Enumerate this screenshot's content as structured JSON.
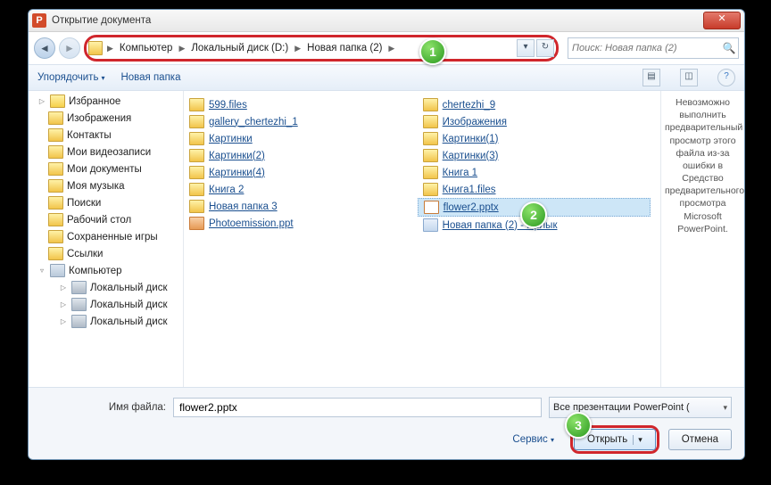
{
  "title": "Открытие документа",
  "breadcrumb": {
    "root": "Компьютер",
    "drive": "Локальный диск (D:)",
    "folder": "Новая папка (2)"
  },
  "search": {
    "placeholder": "Поиск: Новая папка (2)"
  },
  "toolbar": {
    "organize": "Упорядочить",
    "newfolder": "Новая папка"
  },
  "tree": {
    "favorites": "Избранное",
    "items": [
      "Изображения",
      "Контакты",
      "Мои видеозаписи",
      "Мои документы",
      "Моя музыка",
      "Поиски",
      "Рабочий стол",
      "Сохраненные игры",
      "Ссылки"
    ],
    "computer": "Компьютер",
    "drives": [
      "Локальный диск",
      "Локальный диск",
      "Локальный диск"
    ]
  },
  "files": {
    "col1": [
      {
        "name": "599.files",
        "type": "folder"
      },
      {
        "name": "gallery_chertezhi_1",
        "type": "folder"
      },
      {
        "name": "Картинки",
        "type": "folder"
      },
      {
        "name": "Картинки(2)",
        "type": "folder"
      },
      {
        "name": "Картинки(4)",
        "type": "folder"
      },
      {
        "name": "Книга 2",
        "type": "folder"
      },
      {
        "name": "Новая папка 3",
        "type": "folder"
      },
      {
        "name": "Photoemission.ppt",
        "type": "ppt"
      }
    ],
    "col2": [
      {
        "name": "chertezhi_9",
        "type": "folder"
      },
      {
        "name": "Изображения",
        "type": "folder"
      },
      {
        "name": "Картинки(1)",
        "type": "folder"
      },
      {
        "name": "Картинки(3)",
        "type": "folder"
      },
      {
        "name": "Книга 1",
        "type": "folder"
      },
      {
        "name": "Книга1.files",
        "type": "folder"
      },
      {
        "name": "flower2.pptx",
        "type": "pptx",
        "selected": true
      },
      {
        "name": "Новая папка (2) - Ярлык",
        "type": "link"
      }
    ]
  },
  "preview": "Невозможно выполнить предварительный просмотр этого файла из-за ошибки в Средство предварительного просмотра Microsoft PowerPoint.",
  "footer": {
    "filenameLabel": "Имя файла:",
    "filename": "flower2.pptx",
    "filetype": "Все презентации PowerPoint (",
    "service": "Сервис",
    "open": "Открыть",
    "cancel": "Отмена"
  },
  "annotations": {
    "a1": "1",
    "a2": "2",
    "a3": "3"
  }
}
